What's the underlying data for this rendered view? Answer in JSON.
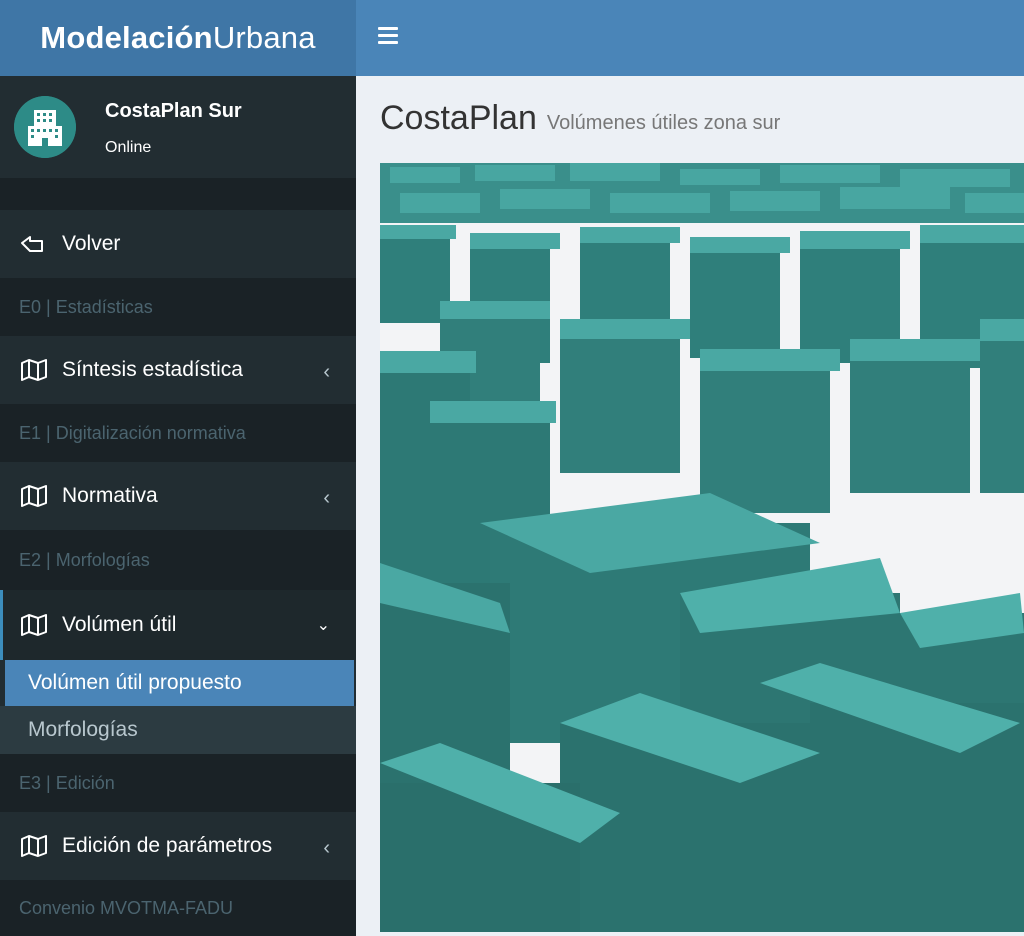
{
  "app": {
    "logo_bold": "Modelación",
    "logo_light": "Urbana"
  },
  "user": {
    "name": "CostaPlan Sur",
    "status": "Online"
  },
  "menu": {
    "back": "Volver",
    "h0": "E0 | Estadísticas",
    "synthesis": "Síntesis estadística",
    "h1": "E1 | Digitalización normativa",
    "normativa": "Normativa",
    "h2": "E2 | Morfologías",
    "volumen": "Volúmen útil",
    "sub_active": "Volúmen útil propuesto",
    "sub_other": "Morfologías",
    "h3": "E3 | Edición",
    "edicion": "Edición de parámetros",
    "footer": "Convenio MVOTMA-FADU"
  },
  "page": {
    "title": "CostaPlan",
    "subtitle": "Volúmenes útiles zona sur"
  },
  "colors": {
    "accent": "#4a85b8",
    "building": "#3a9a96",
    "sidebar": "#222d32"
  }
}
